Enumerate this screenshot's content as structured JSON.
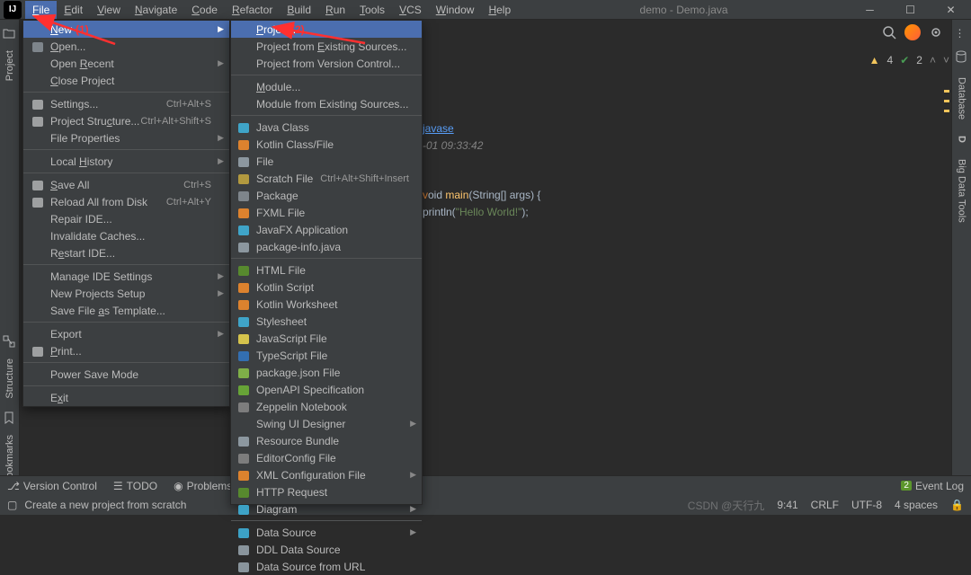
{
  "titlebar": {
    "app_name": "IJ",
    "title": "demo - Demo.java"
  },
  "menubar": [
    "File",
    "Edit",
    "View",
    "Navigate",
    "Code",
    "Refactor",
    "Build",
    "Run",
    "Tools",
    "VCS",
    "Window",
    "Help"
  ],
  "menubar_active": 0,
  "file_menu": [
    {
      "label": "New",
      "icon": "",
      "highlight": true,
      "arrow": true,
      "mnemonic": 0
    },
    {
      "label": "Open...",
      "icon": "folder",
      "mnemonic": 0
    },
    {
      "label": "Open Recent",
      "arrow": true,
      "mnemonic": 5
    },
    {
      "label": "Close Project",
      "mnemonic": 0
    },
    {
      "sep": true
    },
    {
      "label": "Settings...",
      "icon": "gear",
      "shortcut": "Ctrl+Alt+S"
    },
    {
      "label": "Project Structure...",
      "icon": "struct",
      "shortcut": "Ctrl+Alt+Shift+S",
      "mnemonic": 12
    },
    {
      "label": "File Properties",
      "arrow": true
    },
    {
      "sep": true
    },
    {
      "label": "Local History",
      "mnemonic": 6,
      "arrow": true
    },
    {
      "sep": true
    },
    {
      "label": "Save All",
      "icon": "save",
      "shortcut": "Ctrl+S",
      "mnemonic": 0
    },
    {
      "label": "Reload All from Disk",
      "icon": "reload",
      "shortcut": "Ctrl+Alt+Y"
    },
    {
      "label": "Repair IDE..."
    },
    {
      "label": "Invalidate Caches..."
    },
    {
      "label": "Restart IDE...",
      "mnemonic": 1
    },
    {
      "sep": true
    },
    {
      "label": "Manage IDE Settings",
      "arrow": true
    },
    {
      "label": "New Projects Setup",
      "arrow": true
    },
    {
      "label": "Save File as Template...",
      "mnemonic": 10
    },
    {
      "sep": true
    },
    {
      "label": "Export",
      "arrow": true
    },
    {
      "label": "Print...",
      "icon": "print",
      "mnemonic": 0
    },
    {
      "sep": true
    },
    {
      "label": "Power Save Mode"
    },
    {
      "sep": true
    },
    {
      "label": "Exit",
      "mnemonic": 1
    }
  ],
  "new_menu": [
    {
      "label": "Project...",
      "highlight": true,
      "mnemonic": 0
    },
    {
      "label": "Project from Existing Sources...",
      "mnemonic": 13
    },
    {
      "label": "Project from Version Control..."
    },
    {
      "sep": true
    },
    {
      "label": "Module...",
      "mnemonic": 0
    },
    {
      "label": "Module from Existing Sources..."
    },
    {
      "sep": true
    },
    {
      "label": "Java Class",
      "icon": "c-blue"
    },
    {
      "label": "Kotlin Class/File",
      "icon": "k-orange"
    },
    {
      "label": "File",
      "icon": "file"
    },
    {
      "label": "Scratch File",
      "icon": "scratch",
      "shortcut": "Ctrl+Alt+Shift+Insert"
    },
    {
      "label": "Package",
      "icon": "folder"
    },
    {
      "label": "FXML File",
      "icon": "fxml"
    },
    {
      "label": "JavaFX Application",
      "icon": "c-blue"
    },
    {
      "label": "package-info.java",
      "icon": "file"
    },
    {
      "sep": true
    },
    {
      "label": "HTML File",
      "icon": "html"
    },
    {
      "label": "Kotlin Script",
      "icon": "k-orange"
    },
    {
      "label": "Kotlin Worksheet",
      "icon": "k-orange"
    },
    {
      "label": "Stylesheet",
      "icon": "css"
    },
    {
      "label": "JavaScript File",
      "icon": "js"
    },
    {
      "label": "TypeScript File",
      "icon": "ts"
    },
    {
      "label": "package.json File",
      "icon": "json"
    },
    {
      "label": "OpenAPI Specification",
      "icon": "openapi"
    },
    {
      "label": "Zeppelin Notebook",
      "icon": "zep"
    },
    {
      "label": "Swing UI Designer",
      "arrow": true
    },
    {
      "label": "Resource Bundle",
      "icon": "bundle"
    },
    {
      "label": "EditorConfig File",
      "icon": "ec"
    },
    {
      "label": "XML Configuration File",
      "icon": "xml",
      "arrow": true
    },
    {
      "label": "HTTP Request",
      "icon": "http"
    },
    {
      "label": "Diagram",
      "icon": "diag",
      "arrow": true
    },
    {
      "sep": true
    },
    {
      "label": "Data Source",
      "icon": "ds",
      "arrow": true
    },
    {
      "label": "DDL Data Source",
      "icon": "ddl"
    },
    {
      "label": "Data Source from URL",
      "icon": "url"
    }
  ],
  "editor_code": {
    "line1_pkg": "javase",
    "line2_date": "-01 09:33:42",
    "line3_sig": "oid main(String[] args) {",
    "line3_v": "v",
    "line4_pre": "println(",
    "line4_str": "\"Hello World!\"",
    "line4_post": ");"
  },
  "status_right": {
    "warn_count": "4",
    "check_count": "2"
  },
  "left_tabs": {
    "project": "Project",
    "structure": "Structure",
    "bookmarks": "Bookmarks"
  },
  "right_tabs": {
    "database": "Database",
    "bigdata": "Big Data Tools",
    "d": "D"
  },
  "statusbar": {
    "version_control": "Version Control",
    "todo": "TODO",
    "problems": "Problems",
    "event_log": "Event Log",
    "event_badge": "2",
    "hint": "Create a new project from scratch",
    "line_col": "9:41",
    "crlf": "CRLF",
    "encoding": "UTF-8",
    "indent": "4 spaces",
    "watermark": "CSDN @天行九"
  },
  "annotations": {
    "a1": "(1)",
    "a2": "(2)"
  },
  "icon_colors": {
    "c-blue": "#40b6e0",
    "k-orange": "#f88e2b",
    "file": "#9aa7b0",
    "folder": "#8a9299",
    "html": "#5c962c",
    "css": "#40b6e0",
    "js": "#f0db4f",
    "ts": "#3178c6",
    "json": "#8bc34a",
    "openapi": "#6fb536",
    "zep": "#888",
    "bundle": "#9aa7b0",
    "ec": "#888",
    "xml": "#f88e2b",
    "http": "#5c962c",
    "diag": "#40b6e0",
    "ds": "#40b6e0",
    "ddl": "#9aa7b0",
    "url": "#9aa7b0",
    "scratch": "#c7a93f",
    "fxml": "#f88e2b",
    "gear": "#afb1b3",
    "struct": "#afb1b3",
    "save": "#afb1b3",
    "reload": "#afb1b3",
    "print": "#afb1b3"
  }
}
